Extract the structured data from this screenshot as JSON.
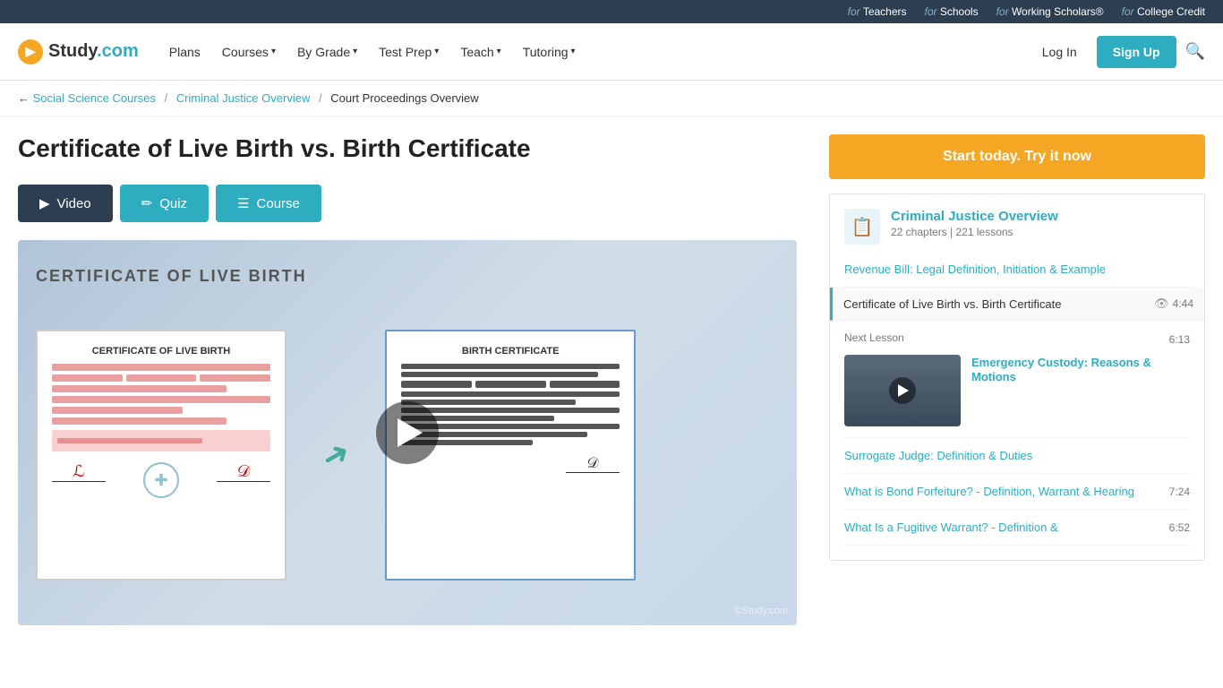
{
  "topbar": {
    "items": [
      {
        "for_label": "for",
        "link_text": "Teachers"
      },
      {
        "for_label": "for",
        "link_text": "Schools"
      },
      {
        "for_label": "for",
        "link_text": "Working Scholars®"
      },
      {
        "for_label": "for",
        "link_text": "College Credit"
      }
    ]
  },
  "nav": {
    "logo_text": "Study.com",
    "links": [
      {
        "label": "Plans"
      },
      {
        "label": "Courses",
        "has_dropdown": true
      },
      {
        "label": "By Grade",
        "has_dropdown": true
      },
      {
        "label": "Test Prep",
        "has_dropdown": true
      },
      {
        "label": "Teach",
        "has_dropdown": true
      },
      {
        "label": "Tutoring",
        "has_dropdown": true
      }
    ],
    "login_label": "Log In",
    "signup_label": "Sign Up"
  },
  "breadcrumb": {
    "back_label": "Social Science Courses",
    "crumb2": "Criminal Justice Overview",
    "crumb3": "Court Proceedings Overview",
    "separator": "/"
  },
  "page": {
    "title": "Certificate of Live Birth vs. Birth Certificate"
  },
  "tabs": {
    "video_label": "Video",
    "quiz_label": "Quiz",
    "course_label": "Course"
  },
  "video": {
    "title": "CERTIFICATE OF LIVE BIRTH",
    "cert_left_title": "CERTIFICATE OF LIVE BIRTH",
    "cert_right_title": "BIRTH CERTIFICATE",
    "watermark": "©Study.com"
  },
  "sidebar": {
    "cta_label": "Start today. Try it now",
    "course_title": "Criminal Justice Overview",
    "course_meta": "22 chapters | 221 lessons",
    "lessons": [
      {
        "type": "link",
        "title": "Revenue Bill: Legal Definition, Initiation & Example",
        "duration": null
      },
      {
        "type": "current",
        "title": "Certificate of Live Birth vs. Birth Certificate",
        "duration": "4:44"
      },
      {
        "type": "next_label",
        "title": "Next Lesson",
        "duration": "6:13"
      },
      {
        "type": "next",
        "title": "Emergency Custody: Reasons & Motions",
        "duration": "6:13"
      },
      {
        "type": "link",
        "title": "Surrogate Judge: Definition & Duties",
        "duration": null
      },
      {
        "type": "link_duration",
        "title": "What is Bond Forfeiture? - Definition, Warrant & Hearing",
        "duration": "7:24"
      },
      {
        "type": "link",
        "title": "What Is a Fugitive Warrant? - Definition &",
        "duration": "6:52"
      }
    ]
  },
  "icons": {
    "play": "▶",
    "eye": "👁",
    "pencil": "✏",
    "list": "☰",
    "book": "📚"
  }
}
